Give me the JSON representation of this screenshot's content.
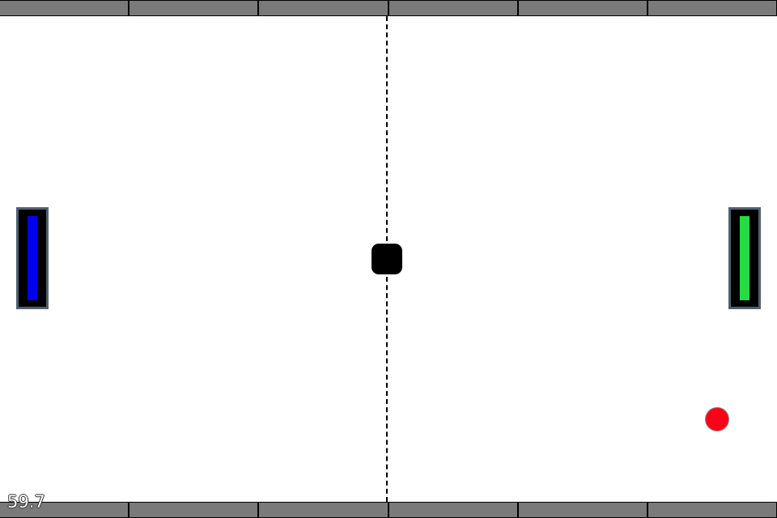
{
  "game": {
    "fps_counter": "59.7",
    "colors": {
      "background": "#ffffff",
      "wall": "#7a7a7a",
      "center_line": "#000000",
      "center_block": "#000000",
      "paddle_frame": "#000000",
      "paddle_border": "#4f6170",
      "left_paddle": "#0000ee",
      "right_paddle": "#22dd44",
      "ball": "#ff0018"
    },
    "wall_segment_count": 6
  }
}
